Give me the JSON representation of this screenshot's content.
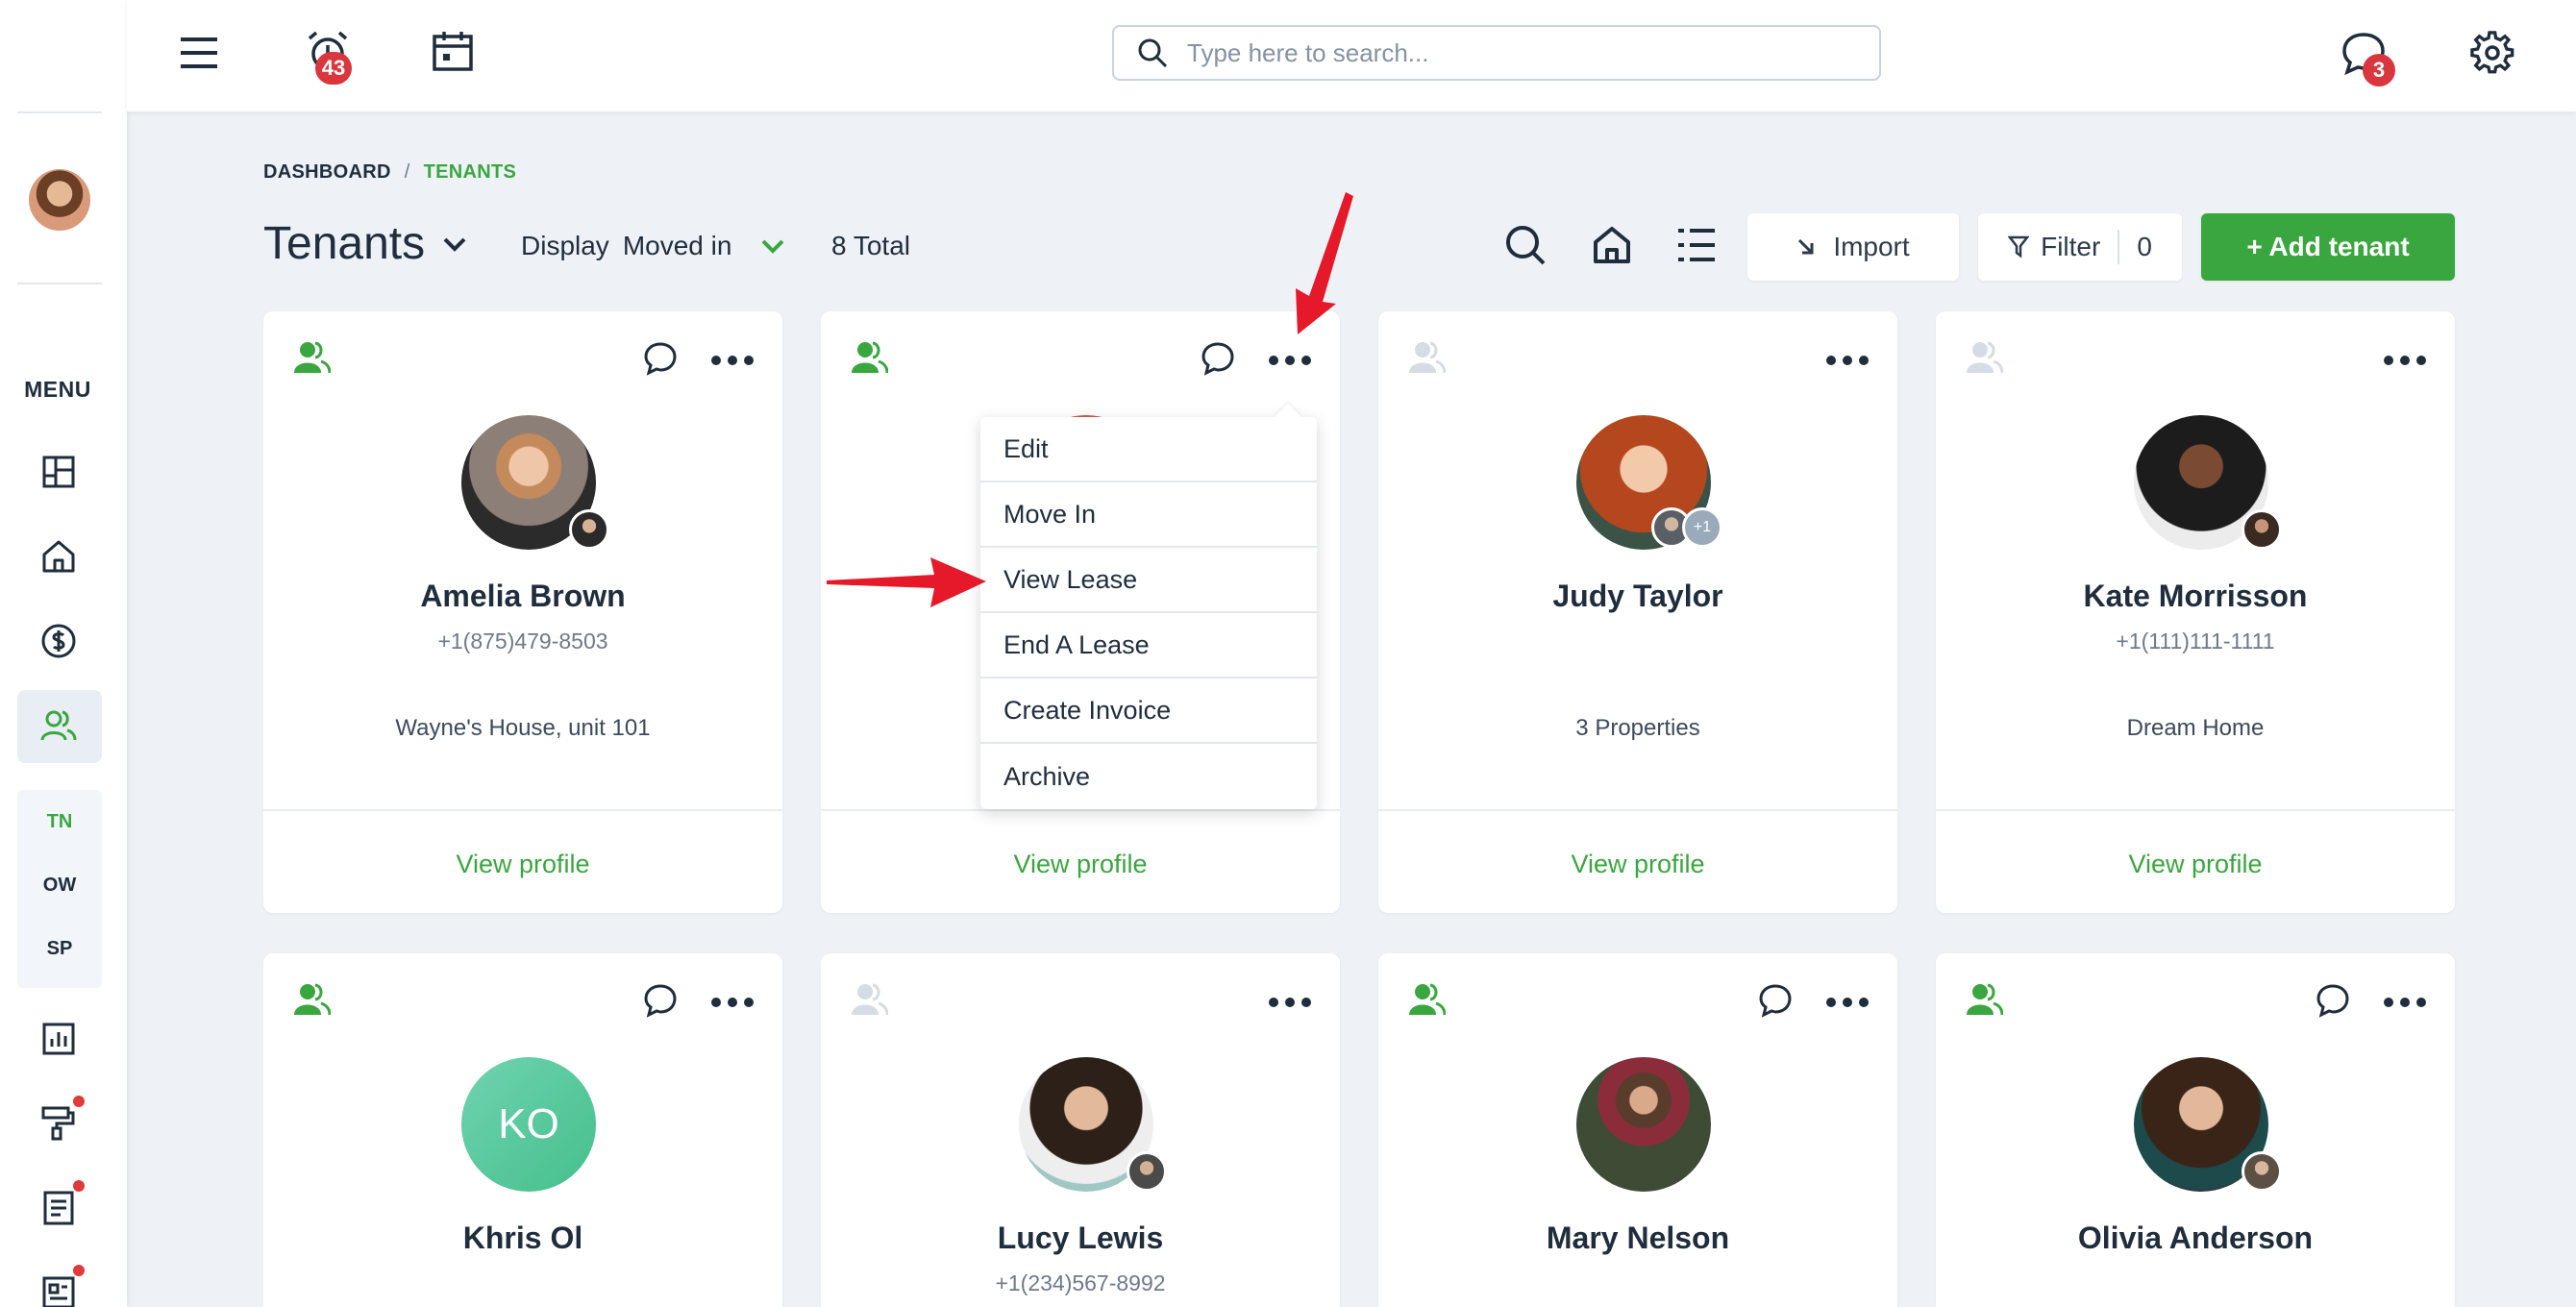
{
  "topbar": {
    "alarm_badge": "43",
    "chat_badge": "3",
    "search_placeholder": "Type here to search..."
  },
  "sidebar": {
    "menu_label": "MENU",
    "sub_items": [
      "TN",
      "OW",
      "SP"
    ]
  },
  "breadcrumb": {
    "root": "DASHBOARD",
    "separator": "/",
    "current": "TENANTS"
  },
  "header": {
    "title": "Tenants",
    "display_label": "Display",
    "display_value": "Moved in",
    "total": "8 Total",
    "import_label": "Import",
    "filter_label": "Filter",
    "filter_count": "0",
    "add_label": "+ Add tenant"
  },
  "cards": [
    {
      "name": "Amelia Brown",
      "phone": "+1(875)479-8503",
      "property": "Wayne's House, unit 101",
      "view": "View profile"
    },
    {
      "name": "",
      "phone": "",
      "property": "",
      "view": "View profile"
    },
    {
      "name": "Judy Taylor",
      "phone": "",
      "property": "3 Properties",
      "view": "View profile",
      "extra_badge": "+1"
    },
    {
      "name": "Kate Morrisson",
      "phone": "+1(111)111-1111",
      "property": "Dream Home",
      "view": "View profile"
    },
    {
      "name": "Khris Ol",
      "initials": "KO"
    },
    {
      "name": "Lucy Lewis",
      "phone": "+1(234)567-8992"
    },
    {
      "name": "Mary Nelson"
    },
    {
      "name": "Olivia Anderson"
    }
  ],
  "dropdown": {
    "items": [
      "Edit",
      "Move In",
      "View Lease",
      "End A Lease",
      "Create Invoice",
      "Archive"
    ]
  },
  "colors": {
    "accent": "#3aa63f",
    "badge": "#d9363e",
    "arrow": "#e5192a"
  }
}
